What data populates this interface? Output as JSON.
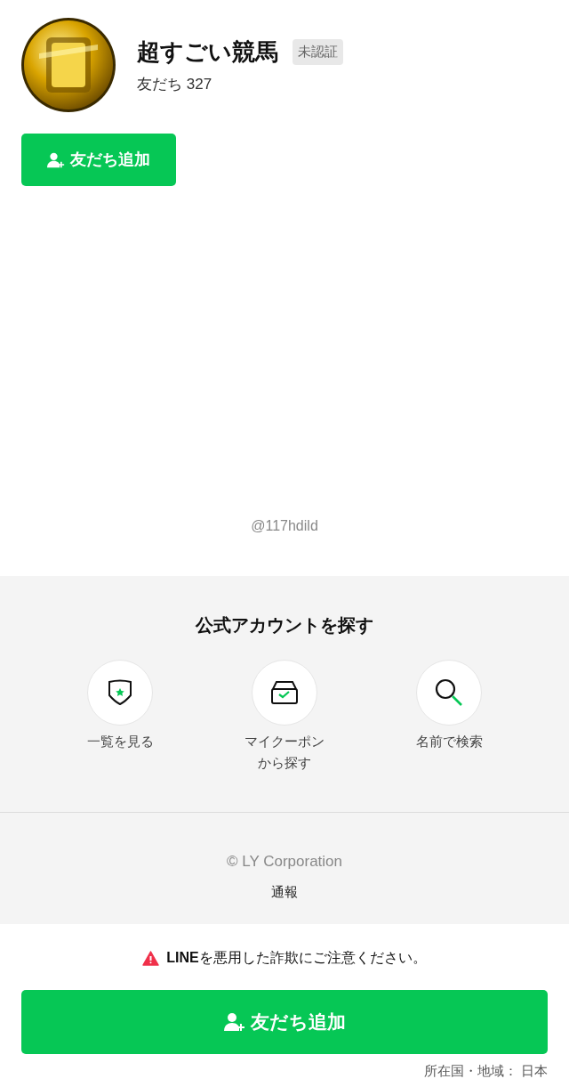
{
  "profile": {
    "name": "超すごい競馬",
    "badge": "未認証",
    "friends_label": "友だち",
    "friends_count": "327"
  },
  "add_button": {
    "label": "友だち追加"
  },
  "account_id": "@117hdild",
  "explore": {
    "title": "公式アカウントを探す",
    "items": [
      {
        "kind": "list",
        "label": "一覧を見る"
      },
      {
        "kind": "coupon",
        "label": "マイクーポンから探す"
      },
      {
        "kind": "search",
        "label": "名前で検索"
      }
    ]
  },
  "footer": {
    "copyright": "© LY Corporation",
    "report": "通報"
  },
  "warning": {
    "prefix": "LINE",
    "text": "を悪用した詐欺にご注意ください。"
  },
  "bottom_button": {
    "label": "友だち追加"
  },
  "region": "所在国・地域： 日本"
}
